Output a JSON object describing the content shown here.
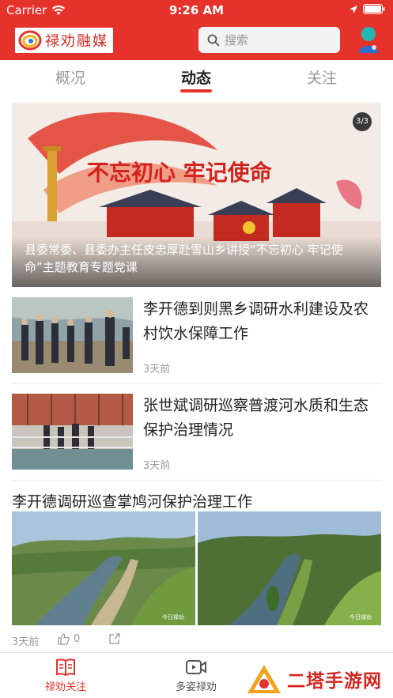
{
  "status_bar": {
    "carrier": "Carrier",
    "time": "9:26 AM"
  },
  "header": {
    "logo_text": "禄劝融媒",
    "search_placeholder": "搜索"
  },
  "tabs": [
    {
      "label": "概况"
    },
    {
      "label": "动态",
      "active": true
    },
    {
      "label": "关注"
    }
  ],
  "banner": {
    "counter": "3/3",
    "slogan": "不忘初心 牢记使命",
    "caption": "县委常委、县委办主任皮忠厚赴雪山乡讲授“不忘初心 牢记使命”主题教育专题党课"
  },
  "news": [
    {
      "title": "李开德到则黑乡调研水利建设及农村饮水保障工作",
      "time": "3天前"
    },
    {
      "title": "张世斌调研巡察普渡河水质和生态保护治理情况",
      "time": "3天前"
    }
  ],
  "feature": {
    "title": "李开德调研巡查掌鸠河保护治理工作",
    "time": "3天前",
    "like_count": "0",
    "image_watermark": "今日禄劝"
  },
  "tabbar": [
    {
      "label": "禄劝关注",
      "active": true
    },
    {
      "label": "多姿禄劝"
    }
  ],
  "watermark": {
    "text": "二塔手游网"
  },
  "colors": {
    "brand_red": "#e5332b",
    "muted_text": "#9a9a9a"
  }
}
